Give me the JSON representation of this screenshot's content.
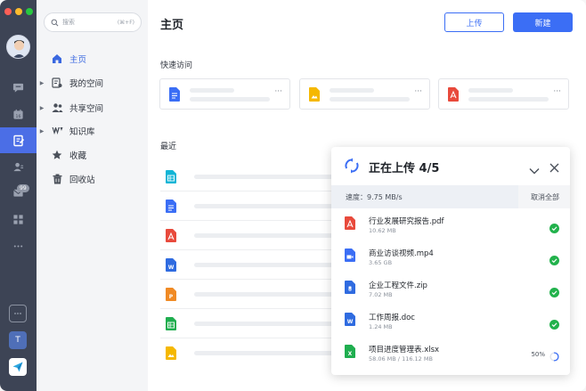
{
  "window": {
    "dot_colors": [
      "#fe5f57",
      "#febc2e",
      "#28c840"
    ]
  },
  "rail": {
    "items": [
      "chat-icon",
      "calendar-icon",
      "docs-icon",
      "contacts-icon",
      "mail-icon",
      "apps-icon",
      "more-icon"
    ],
    "mail_badge": "99",
    "workspace_initial": "T"
  },
  "search": {
    "placeholder": "搜索",
    "shortcut": "(⌘+F)"
  },
  "nav": [
    {
      "label": "主页",
      "icon": "home-icon",
      "expandable": false,
      "active": true
    },
    {
      "label": "我的空间",
      "icon": "my-space-icon",
      "expandable": true,
      "active": false
    },
    {
      "label": "共享空间",
      "icon": "shared-space-icon",
      "expandable": true,
      "active": false
    },
    {
      "label": "知识库",
      "icon": "wiki-icon",
      "expandable": true,
      "active": false
    },
    {
      "label": "收藏",
      "icon": "star-icon",
      "expandable": false,
      "active": false
    },
    {
      "label": "回收站",
      "icon": "trash-icon",
      "expandable": false,
      "active": false
    }
  ],
  "main": {
    "title": "主页",
    "upload_label": "上传",
    "new_label": "新建",
    "quick_access_label": "快速访问",
    "recent_label": "最近",
    "quick_items": [
      {
        "icon": "doc-file-icon",
        "more": "···"
      },
      {
        "icon": "image-file-icon",
        "more": "···"
      },
      {
        "icon": "pdf-file-icon",
        "more": "···"
      }
    ],
    "recent_items": [
      "sheet-file-icon",
      "doc-file-icon",
      "pdf-file-icon",
      "word-file-icon",
      "ppt-file-icon",
      "excel-file-icon",
      "image-file-icon"
    ]
  },
  "upload_panel": {
    "title": "正在上传 4/5",
    "speed": "速度：9.75 MB/s",
    "cancel_all": "取消全部",
    "files": [
      {
        "name": "行业发展研究报告.pdf",
        "size": "10.62 MB",
        "type": "pdf",
        "status": "done"
      },
      {
        "name": "商业访谈视频.mp4",
        "size": "3.65 GB",
        "type": "video",
        "status": "done"
      },
      {
        "name": "企业工程文件.zip",
        "size": "7.02 MB",
        "type": "zip",
        "status": "done"
      },
      {
        "name": "工作周报.doc",
        "size": "1.24 MB",
        "type": "word",
        "status": "done"
      },
      {
        "name": "项目进度管理表.xlsx",
        "size": "58.06 MB / 116.12 MB",
        "type": "excel",
        "status": "uploading",
        "progress": "50%",
        "progress_fraction": 0.5
      }
    ]
  }
}
